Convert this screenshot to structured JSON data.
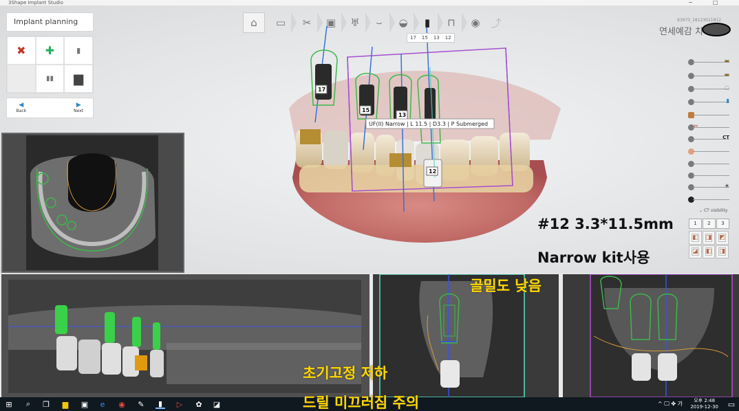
{
  "window": {
    "title": "3Shape Implant Studio",
    "min": "−",
    "max": "□"
  },
  "toolbar": {
    "tooth_tabs": [
      "17",
      "15",
      "13",
      "12"
    ]
  },
  "tool_panel": {
    "title": "Implant planning",
    "back_label": "Back",
    "next_label": "Next"
  },
  "patient": {
    "id": "93970_18123011812",
    "name": "연세예감 치"
  },
  "implants": {
    "labels": [
      "17",
      "15",
      "13",
      "12"
    ],
    "tooltip": "UF(II) Narrow | L 11.5 | D3.3 | P Submerged"
  },
  "visibility": {
    "ct_label": "CT",
    "toggle_label": "CT visibility",
    "view_tabs": [
      "1",
      "2",
      "3"
    ]
  },
  "annotations": {
    "spec": "#12  3.3*11.5mm",
    "kit": "Narrow kit사용",
    "bone_density": "골밀도 낮음",
    "stability": "초기고정 저하",
    "drill": "드릴 미끄러짐 주의"
  },
  "taskbar": {
    "time": "오후 2:48",
    "date": "2019-12-30",
    "tray": "^ 🖵 ✤ 가"
  },
  "colors": {
    "accent_blue": "#2e86c1",
    "implant_outline_green": "#3db84a",
    "bounding_box_purple": "#a64fd0",
    "annotation_yellow": "#ffd800",
    "taskbar": "#101820"
  }
}
